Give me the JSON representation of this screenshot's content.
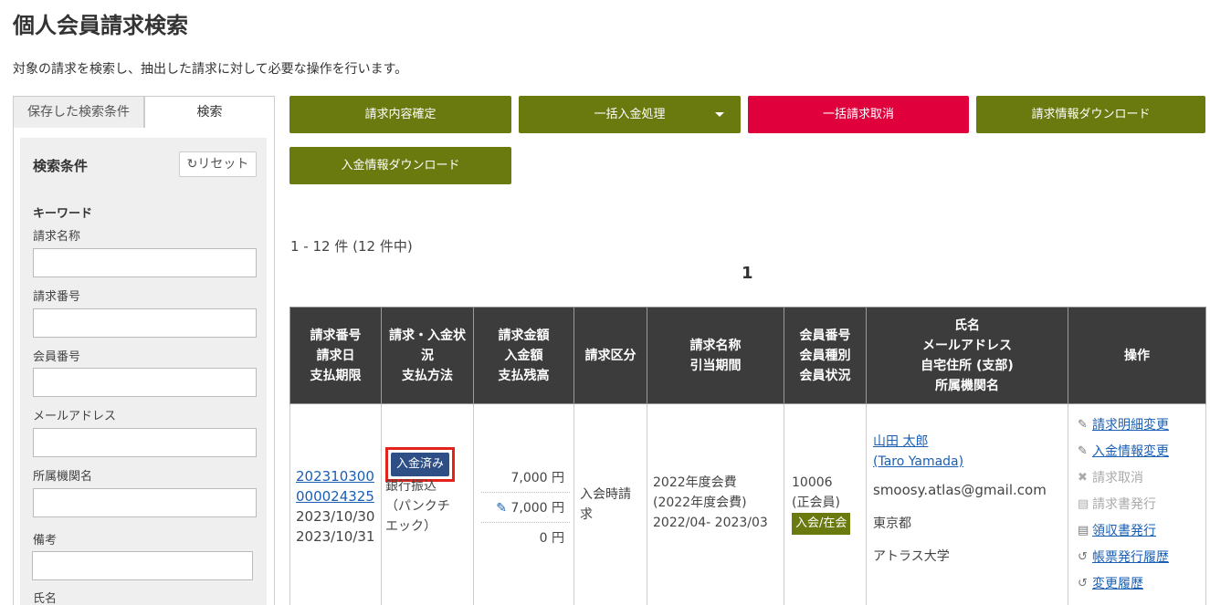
{
  "page": {
    "title": "個人会員請求検索",
    "description": "対象の請求を検索し、抽出した請求に対して必要な操作を行います。"
  },
  "sidebar": {
    "tabs": [
      "保存した検索条件",
      "検索"
    ],
    "condition_title": "検索条件",
    "reset_label": "リセット",
    "keyword_title": "キーワード",
    "fields": [
      "請求名称",
      "請求番号",
      "会員番号",
      "メールアドレス",
      "所属機関名",
      "備考",
      "氏名"
    ]
  },
  "actions": {
    "confirm": "請求内容確定",
    "bulk_payment": "一括入金処理",
    "bulk_cancel": "一括請求取消",
    "invoice_download": "請求情報ダウンロード",
    "payment_download": "入金情報ダウンロード"
  },
  "results": {
    "count": "1 - 12 件 (12 件中)",
    "page": "1"
  },
  "table": {
    "headers": [
      [
        "請求番号",
        "請求日",
        "支払期限"
      ],
      [
        "請求・入金状",
        "況",
        "支払方法"
      ],
      [
        "請求金額",
        "入金額",
        "支払残高"
      ],
      [
        "請求区分"
      ],
      [
        "請求名称",
        "引当期間"
      ],
      [
        "会員番号",
        "会員種別",
        "会員状況"
      ],
      [
        "氏名",
        "メールアドレス",
        "自宅住所 (支部)",
        "所属機関名"
      ],
      [
        "操作"
      ]
    ],
    "row": {
      "invoice_no_1": "202310300",
      "invoice_no_2": "000024325",
      "invoice_date": "2023/10/30",
      "due_date": "2023/10/31",
      "status_badge": "入金済み",
      "pay_method_1": "銀行振込",
      "pay_method_2": "（パンクチ",
      "pay_method_3": "エック）",
      "amount": "7,000 円",
      "paid": "7,000 円",
      "balance": "0 円",
      "category": "入会時請求",
      "name_1": "2022年度会費",
      "name_2": "(2022年度会費)",
      "period": "2022/04- 2023/03",
      "member_no": "10006",
      "member_type": "(正会員)",
      "member_status": "入会/在会",
      "person_name": "山田 太郎",
      "person_name_en": "(Taro Yamada)",
      "email": "smoosy.atlas@gmail.com",
      "address": "東京都",
      "org": "アトラス大学",
      "ops": [
        "請求明細変更",
        "入金情報変更",
        "請求取消",
        "請求書発行",
        "領収書発行",
        "帳票発行履歴",
        "変更履歴"
      ]
    }
  },
  "colors": {
    "olive": "#6b7a0e",
    "red": "#e0003c",
    "header": "#3c3c3c",
    "paid_badge": "#2d4f86"
  }
}
